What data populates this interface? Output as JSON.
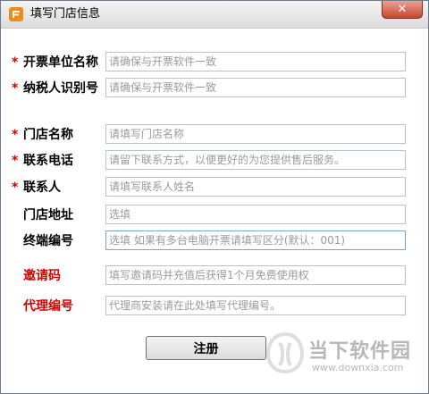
{
  "window": {
    "title": "填写门店信息",
    "close_glyph": "✕"
  },
  "form": {
    "fields": [
      {
        "required": "*",
        "label": "开票单位名称",
        "placeholder": "请确保与开票软件一致"
      },
      {
        "required": "*",
        "label": "纳税人识别号",
        "placeholder": "请确保与开票软件一致"
      },
      {
        "required": "*",
        "label": "门店名称",
        "placeholder": "请填写门店名称"
      },
      {
        "required": "*",
        "label": "联系电话",
        "placeholder": "请留下联系方式，以便更好的为您提供售后服务。"
      },
      {
        "required": "*",
        "label": "联系人",
        "placeholder": "请填写联系人姓名"
      },
      {
        "required": "",
        "label": "门店地址",
        "placeholder": "选填"
      },
      {
        "required": "",
        "label": "终端编号",
        "placeholder": "选填  如果有多台电脑开票请填写区分(默认：001)"
      },
      {
        "required": "",
        "label": "邀请码",
        "placeholder": "填写邀请码并充值后获得1个月免费使用权"
      },
      {
        "required": "",
        "label": "代理编号",
        "placeholder": "代理商安装请在此处填写代理编号。"
      }
    ],
    "submit_label": "注册"
  },
  "watermark": {
    "name": "当下软件园",
    "url": "www.downxia.com"
  },
  "colors": {
    "required_star": "#d40000",
    "red_label": "#d40000",
    "placeholder": "#9a9a9a",
    "close_button": "#c8452c"
  },
  "icons": {
    "app": "app-logo-icon",
    "close": "close-icon"
  }
}
